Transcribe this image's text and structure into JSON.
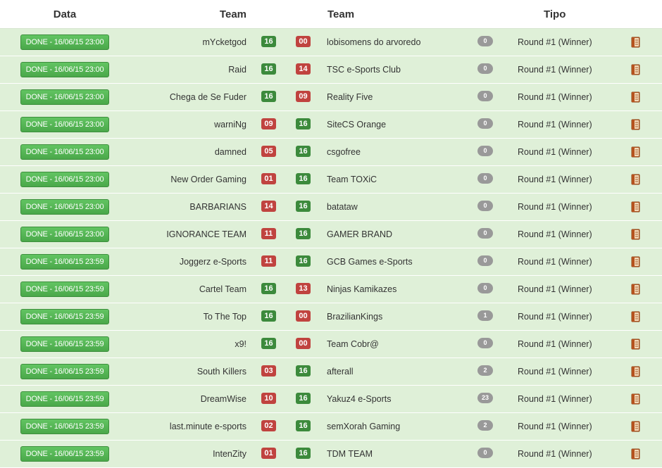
{
  "headers": {
    "data": "Data",
    "team1": "Team",
    "team2": "Team",
    "tipo": "Tipo"
  },
  "colors": {
    "row_bg": "#dff0d8",
    "done_green": "#5cb85c",
    "win_score": "#3c8a3c",
    "lose_score": "#c0433f",
    "badge_gray": "#999999"
  },
  "icons": {
    "action": "book-icon"
  },
  "matches": [
    {
      "date": "DONE - 16/06/15 23:00",
      "team1": "mYcketgod",
      "score1": "16",
      "score2": "00",
      "team2": "lobisomens do arvoredo",
      "comments": "0",
      "tipo": "Round #1 (Winner)"
    },
    {
      "date": "DONE - 16/06/15 23:00",
      "team1": "Raid",
      "score1": "16",
      "score2": "14",
      "team2": "TSC e-Sports Club",
      "comments": "0",
      "tipo": "Round #1 (Winner)"
    },
    {
      "date": "DONE - 16/06/15 23:00",
      "team1": "Chega de Se Fuder",
      "score1": "16",
      "score2": "09",
      "team2": "Reality Five",
      "comments": "0",
      "tipo": "Round #1 (Winner)"
    },
    {
      "date": "DONE - 16/06/15 23:00",
      "team1": "warniNg",
      "score1": "09",
      "score2": "16",
      "team2": "SiteCS Orange",
      "comments": "0",
      "tipo": "Round #1 (Winner)"
    },
    {
      "date": "DONE - 16/06/15 23:00",
      "team1": "damned",
      "score1": "05",
      "score2": "16",
      "team2": "csgofree",
      "comments": "0",
      "tipo": "Round #1 (Winner)"
    },
    {
      "date": "DONE - 16/06/15 23:00",
      "team1": "New Order Gaming",
      "score1": "01",
      "score2": "16",
      "team2": "Team TOXiC",
      "comments": "0",
      "tipo": "Round #1 (Winner)"
    },
    {
      "date": "DONE - 16/06/15 23:00",
      "team1": "BARBARIANS",
      "score1": "14",
      "score2": "16",
      "team2": "batataw",
      "comments": "0",
      "tipo": "Round #1 (Winner)"
    },
    {
      "date": "DONE - 16/06/15 23:00",
      "team1": "IGNORANCE TEAM",
      "score1": "11",
      "score2": "16",
      "team2": "GAMER BRAND",
      "comments": "0",
      "tipo": "Round #1 (Winner)"
    },
    {
      "date": "DONE - 16/06/15 23:59",
      "team1": "Joggerz e-Sports",
      "score1": "11",
      "score2": "16",
      "team2": "GCB Games e-Sports",
      "comments": "0",
      "tipo": "Round #1 (Winner)"
    },
    {
      "date": "DONE - 16/06/15 23:59",
      "team1": "Cartel Team",
      "score1": "16",
      "score2": "13",
      "team2": "Ninjas Kamikazes",
      "comments": "0",
      "tipo": "Round #1 (Winner)"
    },
    {
      "date": "DONE - 16/06/15 23:59",
      "team1": "To The Top",
      "score1": "16",
      "score2": "00",
      "team2": "BrazilianKings",
      "comments": "1",
      "tipo": "Round #1 (Winner)"
    },
    {
      "date": "DONE - 16/06/15 23:59",
      "team1": "x9!",
      "score1": "16",
      "score2": "00",
      "team2": "Team Cobr@",
      "comments": "0",
      "tipo": "Round #1 (Winner)"
    },
    {
      "date": "DONE - 16/06/15 23:59",
      "team1": "South Killers",
      "score1": "03",
      "score2": "16",
      "team2": "afterall",
      "comments": "2",
      "tipo": "Round #1 (Winner)"
    },
    {
      "date": "DONE - 16/06/15 23:59",
      "team1": "DreamWise",
      "score1": "10",
      "score2": "16",
      "team2": "Yakuz4 e-Sports",
      "comments": "23",
      "tipo": "Round #1 (Winner)"
    },
    {
      "date": "DONE - 16/06/15 23:59",
      "team1": "last.minute e-sports",
      "score1": "02",
      "score2": "16",
      "team2": "semXorah Gaming",
      "comments": "2",
      "tipo": "Round #1 (Winner)"
    },
    {
      "date": "DONE - 16/06/15 23:59",
      "team1": "IntenZity",
      "score1": "01",
      "score2": "16",
      "team2": "TDM TEAM",
      "comments": "0",
      "tipo": "Round #1 (Winner)"
    }
  ]
}
